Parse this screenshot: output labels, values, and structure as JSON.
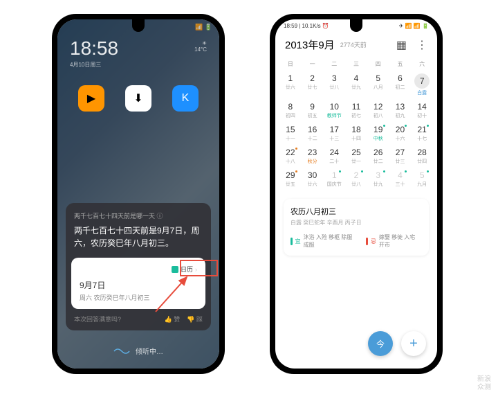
{
  "phone1": {
    "status_time": "",
    "time": "18:58",
    "date": "4月10日周三",
    "weather": "14°C",
    "apps": [
      "腾讯视频",
      "应用商店",
      "酷狗音乐"
    ],
    "card": {
      "question": "两千七百七十四天前是哪一天 ⓘ",
      "answer": "两千七百七十四天前是9月7日，周六，农历癸巳年八月初三。",
      "tag": "日历",
      "sub_title": "9月7日",
      "sub_detail": "周六 农历癸巳年八月初三",
      "feedback_q": "本次回答满意吗?",
      "like": "👍 赞",
      "dislike": "👎 踩"
    },
    "listening": "倾听中…"
  },
  "phone2": {
    "status_left": "18:59 | 10.1K/s ⏰",
    "status_right": "✈ 📶 📶 🔋",
    "title": "2013年9月",
    "subtitle": "2774天前",
    "weekdays": [
      "日",
      "一",
      "二",
      "三",
      "四",
      "五",
      "六"
    ],
    "rows": [
      [
        {
          "d": "1",
          "l": "廿六"
        },
        {
          "d": "2",
          "l": "廿七"
        },
        {
          "d": "3",
          "l": "廿八"
        },
        {
          "d": "4",
          "l": "廿九"
        },
        {
          "d": "5",
          "l": "八月"
        },
        {
          "d": "6",
          "l": "初二"
        },
        {
          "d": "7",
          "l": "白露",
          "sel": true
        }
      ],
      [
        {
          "d": "8",
          "l": "初四"
        },
        {
          "d": "9",
          "l": "初五"
        },
        {
          "d": "10",
          "l": "教师节",
          "teal": true
        },
        {
          "d": "11",
          "l": "初七"
        },
        {
          "d": "12",
          "l": "初八"
        },
        {
          "d": "13",
          "l": "初九"
        },
        {
          "d": "14",
          "l": "初十"
        }
      ],
      [
        {
          "d": "15",
          "l": "十一"
        },
        {
          "d": "16",
          "l": "十二"
        },
        {
          "d": "17",
          "l": "十三"
        },
        {
          "d": "18",
          "l": "十四"
        },
        {
          "d": "19",
          "l": "中秋",
          "teal": true,
          "dg": true
        },
        {
          "d": "20",
          "l": "十六",
          "dg": true
        },
        {
          "d": "21",
          "l": "十七",
          "dg": true
        }
      ],
      [
        {
          "d": "22",
          "l": "十八",
          "dor": true
        },
        {
          "d": "23",
          "l": "秋分",
          "orange": true
        },
        {
          "d": "24",
          "l": "二十"
        },
        {
          "d": "25",
          "l": "廿一"
        },
        {
          "d": "26",
          "l": "廿二"
        },
        {
          "d": "27",
          "l": "廿三"
        },
        {
          "d": "28",
          "l": "廿四"
        }
      ],
      [
        {
          "d": "29",
          "l": "廿五",
          "dor": true
        },
        {
          "d": "30",
          "l": "廿六"
        },
        {
          "d": "1",
          "l": "国庆节",
          "other": true,
          "dg": true
        },
        {
          "d": "2",
          "l": "廿八",
          "other": true,
          "dg": true
        },
        {
          "d": "3",
          "l": "廿九",
          "other": true,
          "dg": true
        },
        {
          "d": "4",
          "l": "三十",
          "other": true,
          "dg": true
        },
        {
          "d": "5",
          "l": "九月",
          "other": true,
          "dg": true
        }
      ]
    ],
    "detail": {
      "title": "农历八月初三",
      "sub": "白露 癸巳蛇年 辛酉月 丙子日",
      "yi_label": "宜",
      "yi": "沐浴 入殓 移柩 除服 成服",
      "ji_label": "忌",
      "ji": "嫁娶 移徙 入宅 开市"
    },
    "today_btn": "今",
    "add_btn": "+"
  },
  "watermark": "新浪\n众测"
}
